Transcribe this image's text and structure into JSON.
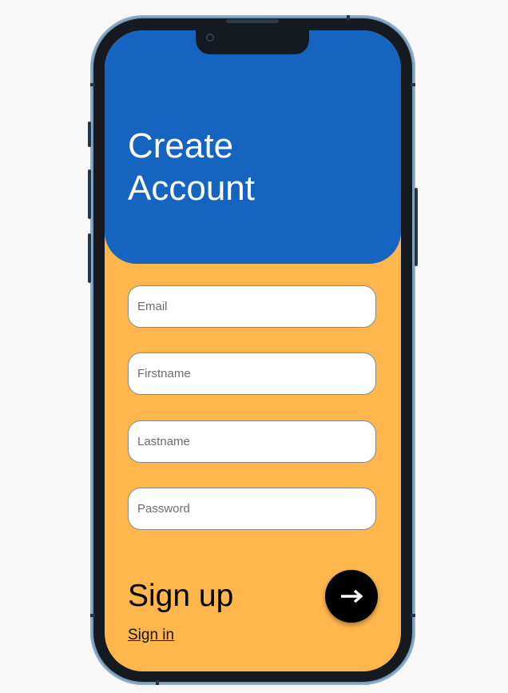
{
  "header": {
    "title_line1": "Create",
    "title_line2": "Account"
  },
  "form": {
    "email_placeholder": "Email",
    "firstname_placeholder": "Firstname",
    "lastname_placeholder": "Lastname",
    "password_placeholder": "Password",
    "email_value": "",
    "firstname_value": "",
    "lastname_value": "",
    "password_value": ""
  },
  "actions": {
    "signup_label": "Sign up",
    "signin_link": "Sign in",
    "submit_icon": "arrow-right-icon"
  },
  "colors": {
    "header_bg": "#1565c0",
    "screen_bg": "#ffb74d",
    "button_bg": "#000000",
    "title_text": "#ffffff"
  }
}
